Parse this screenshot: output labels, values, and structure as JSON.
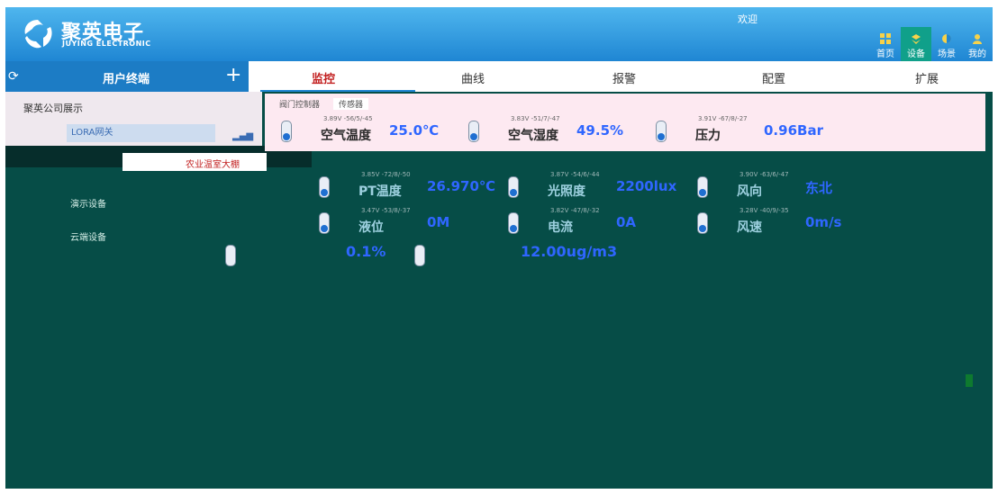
{
  "brand": {
    "cn": "聚英电子",
    "en": "JUYING ELECTRONIC"
  },
  "header": {
    "welcome": "欢迎"
  },
  "topnav": [
    {
      "label": "首页",
      "icon": "grid-icon"
    },
    {
      "label": "设备",
      "icon": "layers-icon",
      "active": true
    },
    {
      "label": "场景",
      "icon": "scene-icon"
    },
    {
      "label": "我的",
      "icon": "user-icon"
    }
  ],
  "sidebar": {
    "title": "用户终端",
    "company": "聚英公司展示",
    "lora_card": "LORA网关",
    "device_card": "农业温室大棚",
    "demo_devices": "演示设备",
    "cloud_devices": "云端设备"
  },
  "tabs": [
    "监控",
    "曲线",
    "报警",
    "配置",
    "扩展"
  ],
  "subtabs": [
    "阀门控制器",
    "传感器"
  ],
  "sensors_row1": [
    {
      "range": "3.89V -56/5/-45",
      "name": "空气温度",
      "value": "25.0℃"
    },
    {
      "range": "3.83V -51/7/-47",
      "name": "空气湿度",
      "value": "49.5%"
    },
    {
      "range": "3.91V -67/8/-27",
      "name": "压力",
      "value": "0.96Bar"
    }
  ],
  "sensors_row2": [
    {
      "range": "3.85V -72/8/-50",
      "name": "PT温度",
      "value": "26.970℃"
    },
    {
      "range": "3.87V -54/6/-44",
      "name": "光照度",
      "value": "2200lux"
    },
    {
      "range": "3.90V -63/6/-47",
      "name": "风向",
      "value": "东北"
    }
  ],
  "sensors_row3": [
    {
      "range": "3.47V -53/8/-37",
      "name": "液位",
      "value": "0M"
    },
    {
      "range": "3.82V -47/8/-32",
      "name": "电流",
      "value": "0A"
    },
    {
      "range": "3.28V -40/9/-35",
      "name": "风速",
      "value": "0m/s"
    }
  ],
  "bottom_values": {
    "co2": "0.1%",
    "pm": "12.00ug/m3"
  },
  "colors": {
    "header_start": "#4fb6ee",
    "header_end": "#1f86d3",
    "accent_red": "#c21f1f",
    "value_blue": "#2f66ff",
    "bg_teal": "#064d47"
  }
}
